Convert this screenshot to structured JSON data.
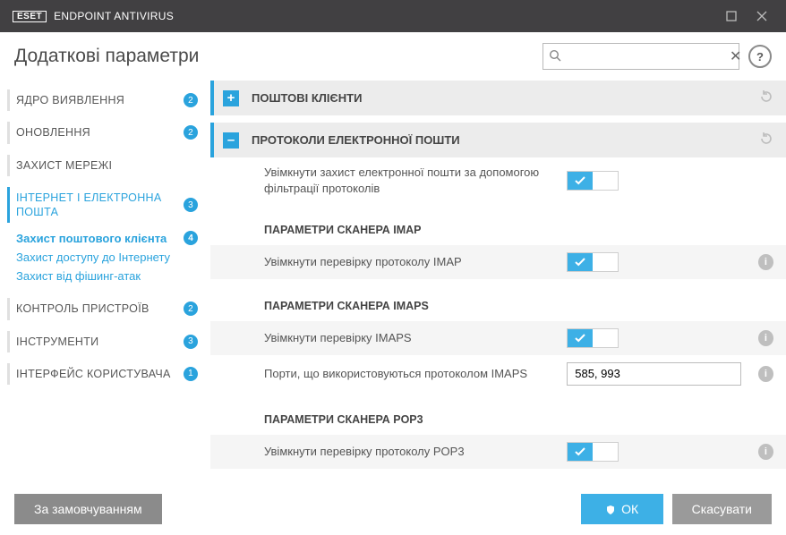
{
  "titlebar": {
    "brand": "ESET",
    "product": "ENDPOINT ANTIVIRUS"
  },
  "header": {
    "title": "Додаткові параметри",
    "search_placeholder": ""
  },
  "sidebar": {
    "items": [
      {
        "label": "ЯДРО ВИЯВЛЕННЯ",
        "badge": "2"
      },
      {
        "label": "ОНОВЛЕННЯ",
        "badge": "2"
      },
      {
        "label": "ЗАХИСТ МЕРЕЖІ",
        "badge": ""
      },
      {
        "label": "ІНТЕРНЕТ І ЕЛЕКТРОННА ПОШТА",
        "badge": "3"
      },
      {
        "label": "КОНТРОЛЬ ПРИСТРОЇВ",
        "badge": "2"
      },
      {
        "label": "ІНСТРУМЕНТИ",
        "badge": "3"
      },
      {
        "label": "ІНТЕРФЕЙС КОРИСТУВАЧА",
        "badge": "1"
      }
    ],
    "subs": [
      {
        "label": "Захист поштового клієнта",
        "badge": "4",
        "selected": true
      },
      {
        "label": "Захист доступу до Інтернету"
      },
      {
        "label": "Захист від фішинг-атак"
      }
    ]
  },
  "sections": {
    "mail_clients": {
      "title": "ПОШТОВІ КЛІЄНТИ"
    },
    "protocols": {
      "title": "ПРОТОКОЛИ ЕЛЕКТРОННОЇ ПОШТИ",
      "enable": "Увімкнути захист електронної пошти за допомогою фільтрації протоколів",
      "imap_heading": "ПАРАМЕТРИ СКАНЕРА IMAP",
      "imap_enable": "Увімкнути перевірку протоколу IMAP",
      "imaps_heading": "ПАРАМЕТРИ СКАНЕРА IMAPS",
      "imaps_enable": "Увімкнути перевірку IMAPS",
      "imaps_ports_label": "Порти, що використовуються протоколом IMAPS",
      "imaps_ports_value": "585, 993",
      "pop3_heading": "ПАРАМЕТРИ СКАНЕРА POP3",
      "pop3_enable": "Увімкнути перевірку протоколу POP3"
    }
  },
  "footer": {
    "default": "За замовчуванням",
    "ok": "ОК",
    "cancel": "Скасувати"
  }
}
